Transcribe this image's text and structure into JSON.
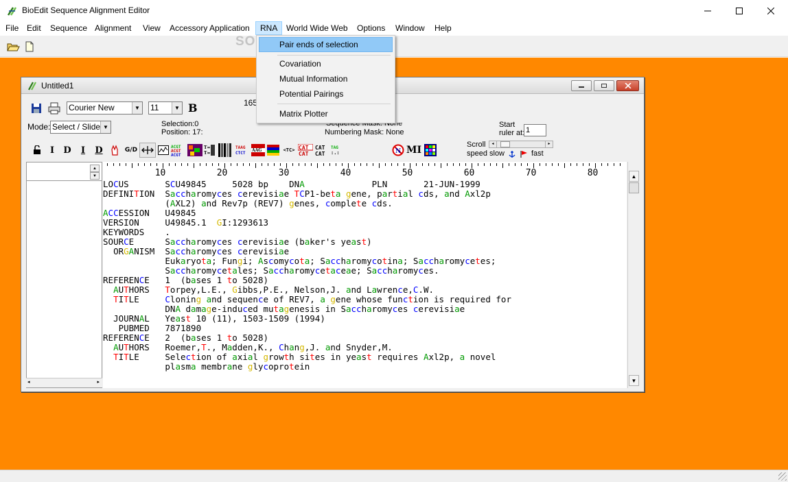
{
  "window": {
    "title": "BioEdit Sequence Alignment Editor"
  },
  "menu": [
    "File",
    "Edit",
    "Sequence",
    "Alignment",
    "View",
    "Accessory Application",
    "RNA",
    "World Wide Web",
    "Options",
    "Window",
    "Help"
  ],
  "rna_menu": {
    "items": [
      "Pair ends of selection",
      "Covariation",
      "Mutual Information",
      "Potential Pairings",
      "Matrix Plotter"
    ]
  },
  "watermark": "SOFTPEDIA",
  "child": {
    "title": "Untitled1",
    "font_name": "Courier New",
    "font_size": "11",
    "bold_label": "B",
    "partial_number": "165",
    "mode_label": "Mode:",
    "mode_value": "Select / Slide",
    "selection_label": "Selection:0",
    "position_label": "Position:  17:",
    "sequence_mask": "Sequence Mask: None",
    "numbering_mask": "Numbering Mask: None",
    "start_label": "Start",
    "ruler_at_label": "ruler at:",
    "ruler_start": "1",
    "scroll_label": "Scroll",
    "speed_label": "speed",
    "slow_label": "slow",
    "fast_label": "fast",
    "mi_label": "MI",
    "ruler_numbers": [
      "10",
      "20",
      "30",
      "40",
      "50",
      "60",
      "70",
      "80"
    ]
  },
  "colors": {
    "orange_bg": "#ff8800",
    "A": "#009900",
    "C": "#0000ff",
    "G": "#d4b800",
    "T": "#ff0000",
    "other": "#000000"
  },
  "sequence_lines": [
    "LOCUS       SCU49845     5028 bp    DNA             PLN       21-JUN-1999",
    "DEFINITION  Saccharomyces cerevisiae TCP1-beta gene, partial cds, and Axl2p",
    "            (AXL2) and Rev7p (REV7) genes, complete cds.",
    "ACCESSION   U49845",
    "VERSION     U49845.1  GI:1293613",
    "KEYWORDS    .",
    "SOURCE      Saccharomyces cerevisiae (baker's yeast)",
    "  ORGANISM  Saccharomyces cerevisiae",
    "            Eukaryota; Fungi; Ascomycota; Saccharomycotina; Saccharomycetes;",
    "            Saccharomycetales; Saccharomycetaceae; Saccharomyces.",
    "REFERENCE   1  (bases 1 to 5028)",
    "  AUTHORS   Torpey,L.E., Gibbs,P.E., Nelson,J. and Lawrence,C.W.",
    "  TITLE     Cloning and sequence of REV7, a gene whose function is required for",
    "            DNA damage-induced mutagenesis in Saccharomyces cerevisiae",
    "  JOURNAL   Yeast 10 (11), 1503-1509 (1994)",
    "   PUBMED   7871890",
    "REFERENCE   2  (bases 1 to 5028)",
    "  AUTHORS   Roemer,T., Madden,K., Chang,J. and Snyder,M.",
    "  TITLE     Selection of axial growth sites in yeast requires Axl2p, a novel",
    "            plasma membrane glycoprotein"
  ]
}
